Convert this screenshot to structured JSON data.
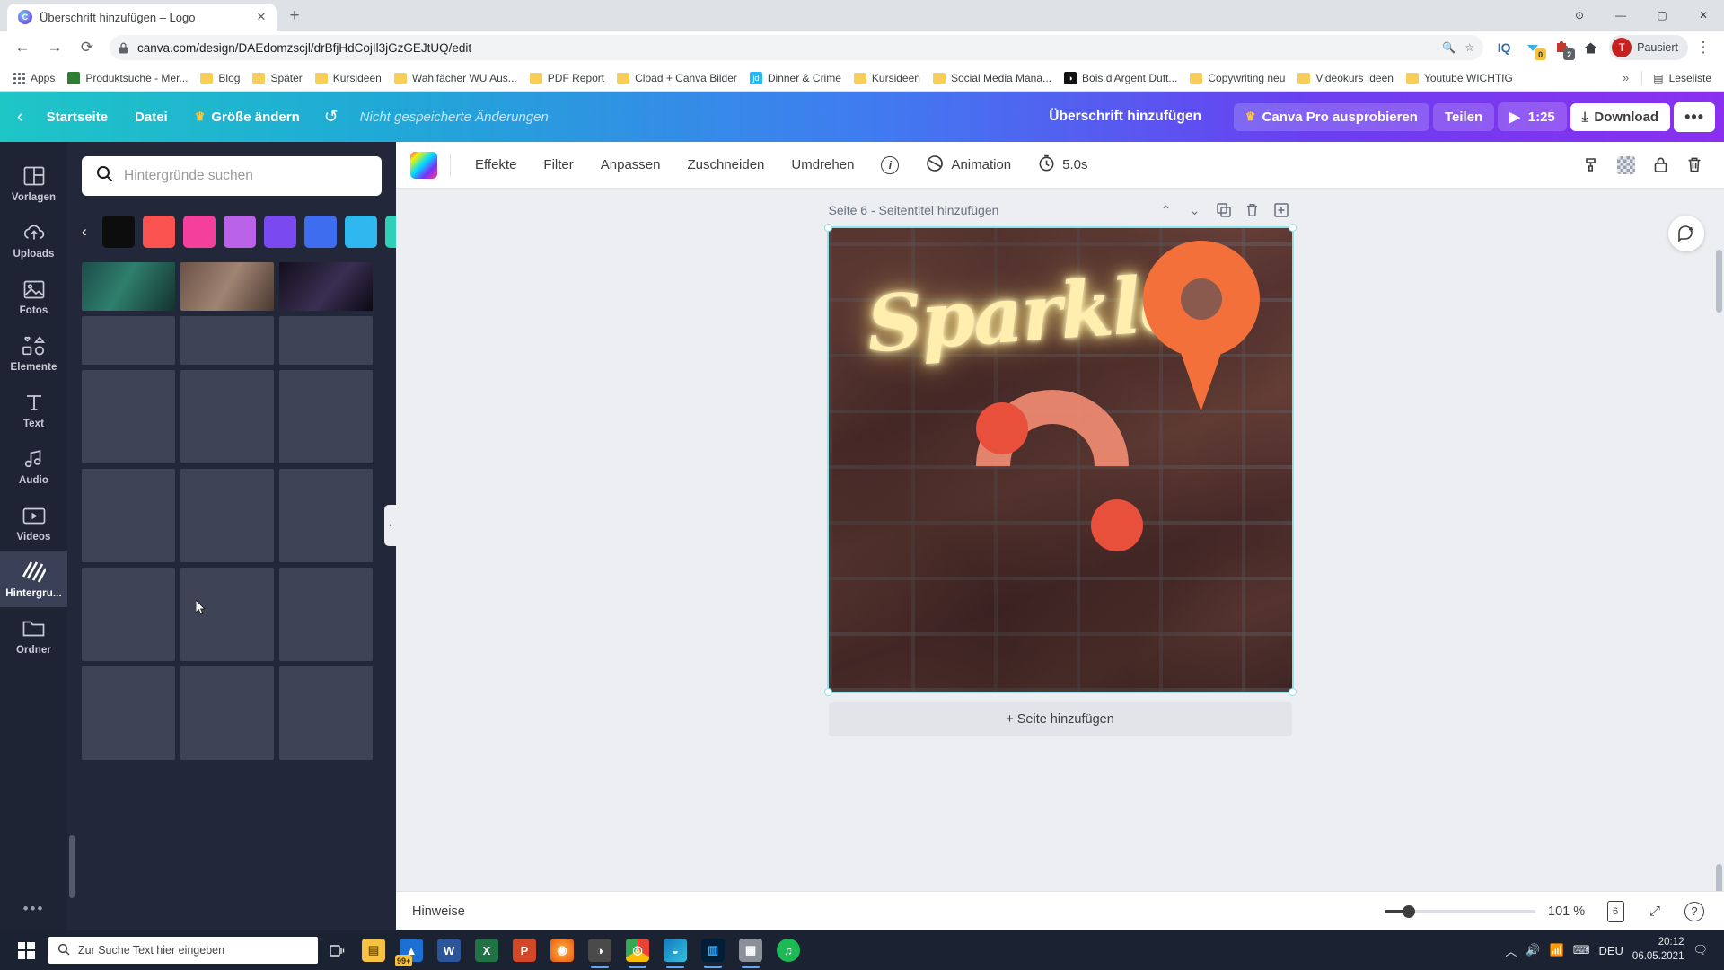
{
  "browser": {
    "tab": {
      "title": "Überschrift hinzufügen – Logo",
      "favicon": "canva-favicon",
      "close_label": "✕"
    },
    "new_tab_label": "+",
    "window_controls": {
      "minimize": "—",
      "maximize": "▢",
      "close": "✕"
    },
    "nav": {
      "back": "←",
      "forward": "→",
      "reload": "⟳"
    },
    "omnibox": {
      "lock_icon": "lock-icon",
      "url": "canva.com/design/DAEdomzscjl/drBfjHdCojIl3jGzGEJtUQ/edit",
      "zoom_icon": "search-icon",
      "star_icon": "star-icon"
    },
    "toolbar_icons": [
      {
        "name": "iq-extension-icon",
        "label": "IQ"
      },
      {
        "name": "pocket-extension-icon",
        "label": "",
        "badge": "0",
        "badge_style": "y"
      },
      {
        "name": "extension-puzzle-icon",
        "label": "",
        "badge": "2",
        "badge_style": "g"
      },
      {
        "name": "home-icon",
        "label": "⌂"
      }
    ],
    "profile": {
      "initial": "T",
      "name": "Pausiert"
    },
    "menu_icon": "kebab-menu-icon",
    "bookmarks": [
      {
        "label": "Apps",
        "icon": "apps-grid-icon"
      },
      {
        "label": "Produktsuche - Mer...",
        "icon": "site-icon",
        "color": "#2e7d32"
      },
      {
        "label": "Blog",
        "icon": "folder-icon"
      },
      {
        "label": "Später",
        "icon": "folder-icon"
      },
      {
        "label": "Kursideen",
        "icon": "folder-icon"
      },
      {
        "label": "Wahlfächer WU Aus...",
        "icon": "folder-icon"
      },
      {
        "label": "PDF Report",
        "icon": "folder-icon"
      },
      {
        "label": "Cload + Canva Bilder",
        "icon": "folder-icon"
      },
      {
        "label": "Dinner & Crime",
        "icon": "site-icon",
        "color": "#29b6f6",
        "text": "jd"
      },
      {
        "label": "Kursideen",
        "icon": "folder-icon"
      },
      {
        "label": "Social Media Mana...",
        "icon": "folder-icon"
      },
      {
        "label": "Bois d'Argent Duft...",
        "icon": "site-icon",
        "color": "#111111",
        "text": "◑"
      },
      {
        "label": "Copywriting neu",
        "icon": "folder-icon"
      },
      {
        "label": "Videokurs Ideen",
        "icon": "folder-icon"
      },
      {
        "label": "Youtube WICHTIG",
        "icon": "folder-icon"
      }
    ],
    "bookmarks_overflow": "»",
    "reading_list": {
      "label": "Leseliste",
      "icon": "reading-list-icon"
    }
  },
  "canva_top": {
    "back_icon": "chevron-left-icon",
    "home": "Startseite",
    "file": "Datei",
    "resize": "Größe ändern",
    "resize_icon": "crown-icon",
    "undo_icon": "undo-icon",
    "unsaved": "Nicht gespeicherte Änderungen",
    "design_title": "Überschrift hinzufügen",
    "try_pro": "Canva Pro ausprobieren",
    "try_pro_icon": "crown-icon",
    "share": "Teilen",
    "play_icon": "play-icon",
    "duration": "1:25",
    "download": "Download",
    "download_icon": "download-icon",
    "more": "•••"
  },
  "rail": {
    "items": [
      {
        "label": "Vorlagen",
        "icon": "templates-icon",
        "active": false
      },
      {
        "label": "Uploads",
        "icon": "upload-cloud-icon",
        "active": false
      },
      {
        "label": "Fotos",
        "icon": "photo-icon",
        "active": false
      },
      {
        "label": "Elemente",
        "icon": "shapes-icon",
        "active": false
      },
      {
        "label": "Text",
        "icon": "text-icon",
        "active": false
      },
      {
        "label": "Audio",
        "icon": "audio-note-icon",
        "active": false
      },
      {
        "label": "Videos",
        "icon": "video-icon",
        "active": false
      },
      {
        "label": "Hintergru...",
        "icon": "background-hatch-icon",
        "active": true
      },
      {
        "label": "Ordner",
        "icon": "folder-icon",
        "active": false
      }
    ],
    "more_icon": "more-dots-icon"
  },
  "panel": {
    "search_placeholder": "Hintergründe suchen",
    "search_icon": "search-icon",
    "prev_icon": "chevron-left-icon",
    "next_icon": "chevron-right-icon",
    "swatches": [
      "#0d0d0d",
      "#f9524f",
      "#f43f9d",
      "#bb63e8",
      "#7b49f0",
      "#3f6df0",
      "#2fb8f0",
      "#2fd0b8"
    ],
    "collapse_icon": "chevron-left-icon"
  },
  "image_toolbar": {
    "swatch_name": "color-swatch",
    "effects": "Effekte",
    "filter": "Filter",
    "adjust": "Anpassen",
    "crop": "Zuschneiden",
    "flip": "Umdrehen",
    "info_icon": "info-icon",
    "animation": "Animation",
    "animation_icon": "animation-icon",
    "timer_icon": "timer-icon",
    "duration": "5.0s",
    "right_icons": [
      {
        "name": "copy-style-icon",
        "glyph": "⌁"
      },
      {
        "name": "transparency-icon",
        "glyph": ""
      },
      {
        "name": "lock-icon",
        "glyph": "🔒"
      },
      {
        "name": "trash-icon",
        "glyph": "🗑"
      }
    ]
  },
  "page": {
    "label": "Seite 6 - Seitentitel hinzufügen",
    "up_icon": "chevron-up-icon",
    "down_icon": "chevron-down-icon",
    "duplicate_icon": "duplicate-icon",
    "delete_icon": "trash-icon",
    "add_icon": "add-page-icon",
    "neon_text": "Sparkle",
    "add_page": "+ Seite hinzufügen",
    "comment_icon": "comment-add-icon"
  },
  "status": {
    "notes": "Hinweise",
    "zoom": "101 %",
    "page_count": "6",
    "page_count_icon": "page-count-icon",
    "fullscreen_icon": "expand-icon",
    "help_icon": "help-icon",
    "notch_icon": "chevron-up-icon"
  },
  "taskbar": {
    "start_icon": "windows-start-icon",
    "search_placeholder": "Zur Suche Text hier eingeben",
    "search_icon": "search-icon",
    "taskview_icon": "task-view-icon",
    "apps": [
      {
        "name": "file-explorer-icon",
        "glyph": "▤",
        "color": "#f6c244",
        "open": false
      },
      {
        "name": "mail-icon",
        "glyph": "▲",
        "color": "#1d6fd4",
        "open": false,
        "badge": "99+"
      },
      {
        "name": "word-icon",
        "glyph": "W",
        "color": "#2b579a",
        "open": false
      },
      {
        "name": "excel-icon",
        "glyph": "X",
        "color": "#217346",
        "open": false
      },
      {
        "name": "powerpoint-icon",
        "glyph": "P",
        "color": "#d24726",
        "open": false
      },
      {
        "name": "firefox-icon",
        "glyph": "◉",
        "color": "#e8590c",
        "open": false
      },
      {
        "name": "browser-alt-icon",
        "glyph": "◑",
        "color": "#4a4a4a",
        "open": true
      },
      {
        "name": "chrome-icon",
        "glyph": "◎",
        "color": "#34a853",
        "open": true
      },
      {
        "name": "edge-icon",
        "glyph": "◒",
        "color": "#0f7bbd",
        "open": true
      },
      {
        "name": "photoshop-icon",
        "glyph": "▥",
        "color": "#001e36",
        "open": true
      },
      {
        "name": "reader-icon",
        "glyph": "▦",
        "color": "#8a8f98",
        "open": true
      },
      {
        "name": "spotify-icon",
        "glyph": "♫",
        "color": "#1db954",
        "open": false
      }
    ],
    "tray": {
      "chevron": "︿",
      "volume_icon": "volume-icon",
      "network_icon": "network-icon",
      "keyboard_icon": "keyboard-icon",
      "language": "DEU",
      "time": "20:12",
      "date": "06.05.2021",
      "notification_icon": "notification-icon"
    }
  }
}
